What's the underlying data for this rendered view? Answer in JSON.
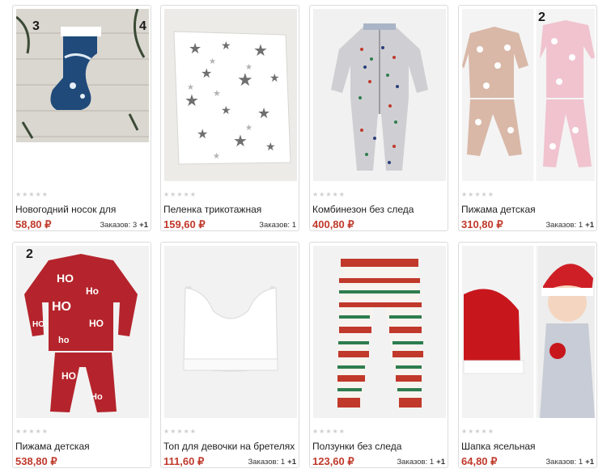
{
  "rating_stars": "★★★★★",
  "price_color": "#c0392b",
  "products": [
    {
      "title": "Новогодний носок для",
      "price": "58,80 ₽",
      "orders": "Заказов: 3",
      "plus": "+1",
      "badge_left": "3",
      "badge_right": "4"
    },
    {
      "title": "Пеленка трикотажная",
      "price": "159,60 ₽",
      "orders": "Заказов: 1",
      "plus": ""
    },
    {
      "title": "Комбинезон без следа",
      "price": "400,80 ₽",
      "orders": "",
      "plus": ""
    },
    {
      "title": "Пижама детская",
      "price": "310,80 ₽",
      "orders": "Заказов: 1",
      "plus": "+1",
      "badge_right": "2"
    },
    {
      "title": "Пижама детская",
      "price": "538,80 ₽",
      "orders": "",
      "plus": "",
      "badge_left": "2"
    },
    {
      "title": "Топ для девочки на бретелях",
      "price": "111,60 ₽",
      "orders": "Заказов: 1",
      "plus": "+1"
    },
    {
      "title": "Ползунки без следа",
      "price": "123,60 ₽",
      "orders": "Заказов: 1",
      "plus": "+1"
    },
    {
      "title": "Шапка ясельная",
      "price": "64,80 ₽",
      "orders": "Заказов: 1",
      "plus": "+1"
    }
  ]
}
